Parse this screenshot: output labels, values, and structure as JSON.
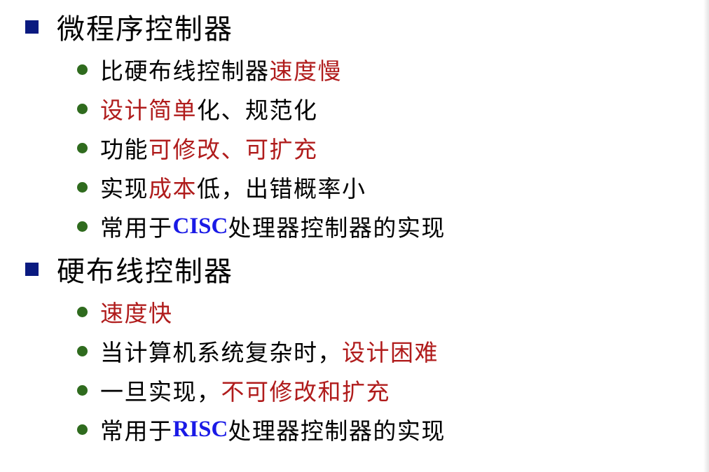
{
  "sections": [
    {
      "title": "微程序控制器",
      "items": [
        [
          "比硬布线控制器",
          "速度慢"
        ],
        [
          "设计简单",
          "化、规范化"
        ],
        [
          "功能",
          "可修改、可扩充"
        ],
        [
          "实现",
          "成本",
          "低，出错概率小"
        ],
        [
          "常用于",
          "CISC",
          "处理器控制器的实现"
        ]
      ]
    },
    {
      "title": "硬布线控制器",
      "items": [
        [
          "速度快"
        ],
        [
          "当计算机系统复杂时，",
          "设计困难"
        ],
        [
          "一旦实现，",
          "不可修改和扩充"
        ],
        [
          "常用于",
          "RISC",
          "处理器控制器的实现"
        ]
      ]
    }
  ],
  "colors": {
    "bullet_square": "#0a1a80",
    "bullet_dot": "#2f6b1e",
    "emphasis_red": "#b01c1c",
    "emphasis_blue": "#1a1ae6"
  },
  "icons": {
    "section_bullet": "square-bullet-icon",
    "item_bullet": "round-bullet-icon"
  }
}
